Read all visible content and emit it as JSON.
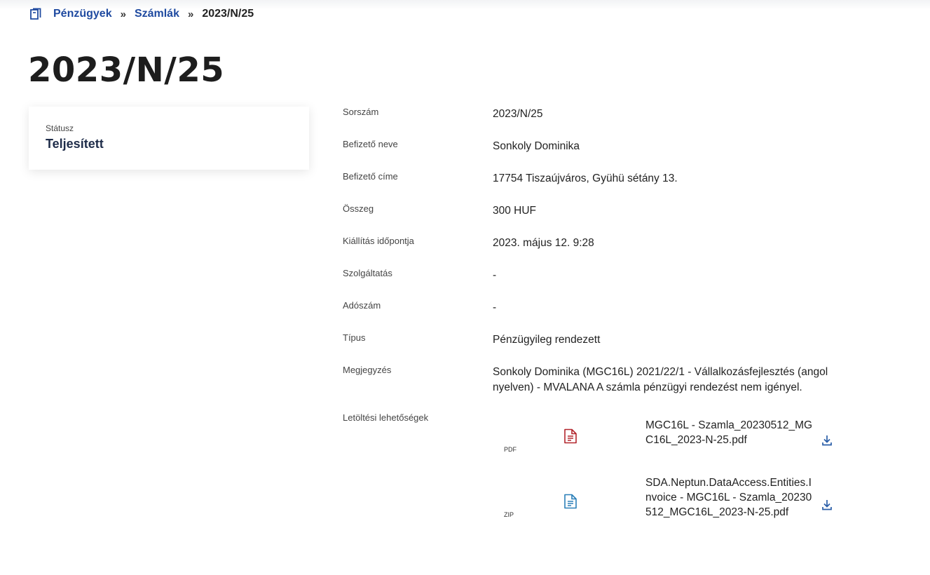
{
  "breadcrumb": {
    "icon": "book-icon",
    "items": [
      "Pénzügyek",
      "Számlák"
    ],
    "separator": "»",
    "current": "2023/N/25"
  },
  "title": "2023/N/25",
  "status": {
    "label": "Státusz",
    "value": "Teljesített"
  },
  "details": [
    {
      "label": "Sorszám",
      "value": "2023/N/25"
    },
    {
      "label": "Befizető neve",
      "value": "Sonkoly Dominika"
    },
    {
      "label": "Befizető címe",
      "value": "17754 Tiszaújváros, Gyühü sétány 13."
    },
    {
      "label": "Összeg",
      "value": "300 HUF"
    },
    {
      "label": "Kiállítás időpontja",
      "value": "2023. május 12. 9:28"
    },
    {
      "label": "Szolgáltatás",
      "value": "-"
    },
    {
      "label": "Adószám",
      "value": "-"
    },
    {
      "label": "Típus",
      "value": "Pénzügyileg rendezett"
    },
    {
      "label": "Megjegyzés",
      "value": "Sonkoly Dominika (MGC16L) 2021/22/1 - Vállalkozásfejlesztés (angol nyelven) - MVALANA A számla pénzügyi rendezést nem igényel."
    }
  ],
  "downloads": {
    "label": "Letöltési lehetőségek",
    "files": [
      {
        "type": "PDF",
        "icon": "pdf-file-icon",
        "color": "#b3262d",
        "name": "MGC16L - Szamla_20230512_MGC16L_2023-N-25.pdf",
        "action_icon": "download-icon"
      },
      {
        "type": "ZIP",
        "icon": "zip-file-icon",
        "color": "#2a7fb8",
        "name": "SDA.Neptun.DataAccess.Entities.Invoice - MGC16L - Szamla_20230512_MGC16L_2023-N-25.pdf",
        "action_icon": "download-icon"
      }
    ]
  },
  "colors": {
    "link": "#1f4aa0",
    "download": "#2a5ea8"
  }
}
